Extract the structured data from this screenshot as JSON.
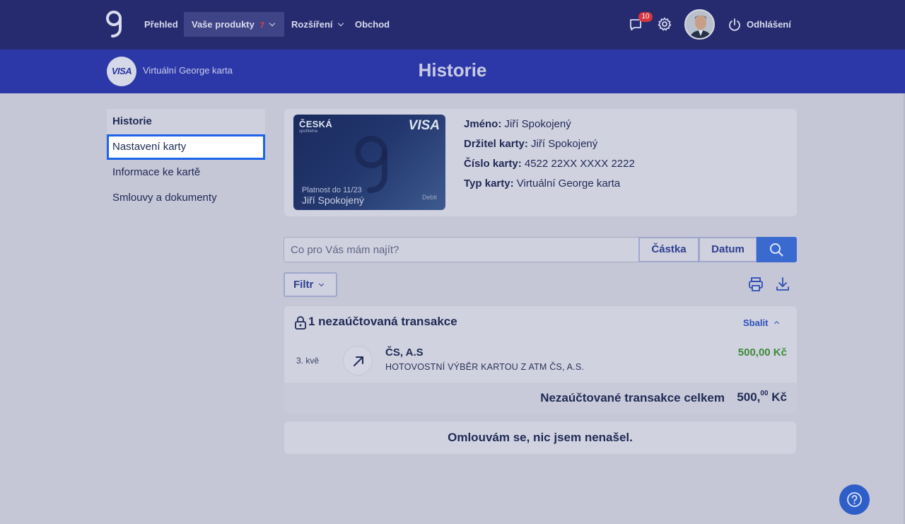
{
  "nav": {
    "prehled": "Přehled",
    "produkty": "Vaše produkty",
    "produkty_badge": "7",
    "rozsireni": "Rozšíření",
    "obchod": "Obchod",
    "messages_badge": "10",
    "logout": "Odhlášení"
  },
  "subheader": {
    "visa_logo": "VISA",
    "card_name": "Virtuální George karta",
    "title": "Historie"
  },
  "sidebar": {
    "items": [
      {
        "label": "Historie"
      },
      {
        "label": "Nastavení karty"
      },
      {
        "label": "Informace ke kartě"
      },
      {
        "label": "Smlouvy a dokumenty"
      }
    ]
  },
  "card": {
    "bank": "ČESKÁ",
    "bank_sub": "spořitelna",
    "network": "VISA",
    "valid": "Platnost do 11/23",
    "holder": "Jiří Spokojený",
    "kind": "Debit"
  },
  "card_info": {
    "name_label": "Jméno:",
    "name_value": "Jiří Spokojený",
    "holder_label": "Držitel karty:",
    "holder_value": "Jiří Spokojený",
    "number_label": "Číslo karty:",
    "number_value": "4522 22XX XXXX 2222",
    "type_label": "Typ karty:",
    "type_value": "Virtuální George karta"
  },
  "search": {
    "placeholder": "Co pro Vás mám najít?",
    "amount_btn": "Částka",
    "date_btn": "Datum"
  },
  "filter": {
    "label": "Filtr"
  },
  "transactions": {
    "title": "1 nezaúčtovaná transakce",
    "collapse": "Sbalit",
    "rows": [
      {
        "date": "3. kvě",
        "merchant": "ČS, A.S",
        "description": "HOTOVOSTNÍ VÝBĚR KARTOU Z ATM ČS, A.S.",
        "amount": "500,00 Kč"
      }
    ],
    "total_label": "Nezaúčtované transakce celkem",
    "total_main": "500,",
    "total_cents": "00",
    "total_currency": " Kč"
  },
  "empty_message": "Omlouvám se, nic jsem nenašel.",
  "colors": {
    "nav_bg": "#252b6e",
    "subheader_bg": "#2d38a8",
    "accent": "#3a6ad0",
    "positive_amount": "#3e8a3a"
  }
}
